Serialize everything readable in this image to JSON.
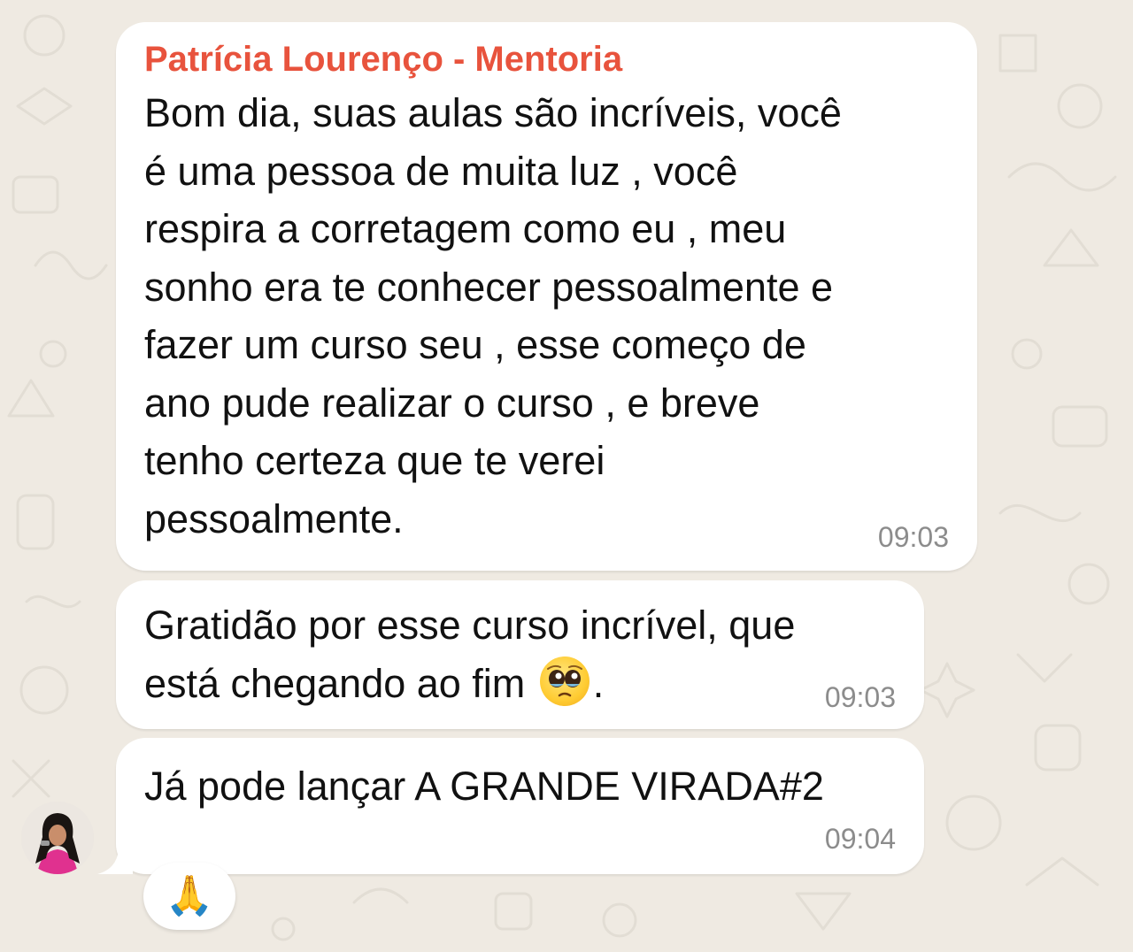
{
  "chat": {
    "wallpaper_color": "#efeae2",
    "messages": [
      {
        "sender": "Patrícia Lourenço - Mentoria",
        "sender_color": "#e8533d",
        "lines": [
          "Bom dia, suas aulas são incríveis, você",
          "é uma pessoa de muita luz , você",
          "respira a corretagem como eu , meu",
          "sonho era te conhecer pessoalmente e",
          "fazer um curso seu , esse começo de",
          "ano pude realizar o curso , e breve",
          "tenho certeza que te verei",
          "pessoalmente."
        ],
        "time": "09:03"
      },
      {
        "line1": "Gratidão por esse curso incrível, que",
        "line2_before": "está chegando ao fim ",
        "line2_emoji": "pleading-face-emoji",
        "line2_after": ".",
        "time": "09:03"
      },
      {
        "text": "Já pode lançar A GRANDE VIRADA#2",
        "time": "09:04"
      }
    ],
    "reaction": {
      "emoji": "🙏",
      "icon": "folded-hands-emoji"
    },
    "avatar": {
      "icon": "sender-avatar"
    }
  }
}
